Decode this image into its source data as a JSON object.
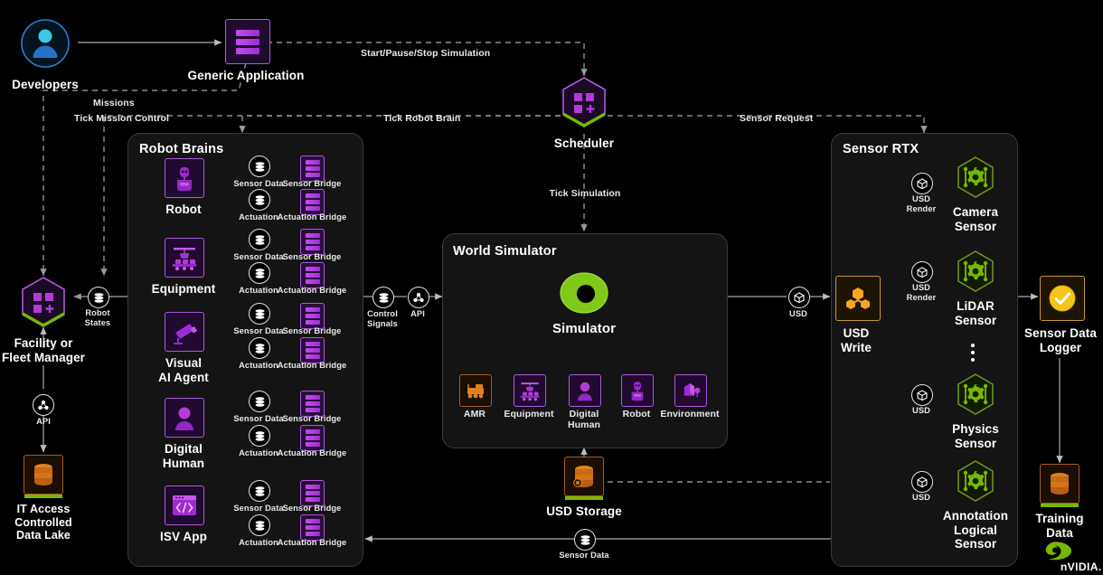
{
  "meta": {
    "brand": "NVIDIA",
    "bg": "#000000",
    "accent_purple": "#a95ad8",
    "accent_green": "#76b900",
    "accent_orange": "#e0811f",
    "accent_amber": "#f5a623"
  },
  "nodes": {
    "developers": {
      "label": "Developers",
      "icon": "person-circle-icon"
    },
    "generic_application": {
      "label": "Generic Application",
      "icon": "server-rack-icon"
    },
    "scheduler": {
      "label": "Scheduler",
      "icon": "hexagon-apps-icon"
    },
    "fleet_manager": {
      "label": "Facility or\nFleet Manager",
      "icon": "hexagon-apps-icon"
    },
    "data_lake": {
      "label": "IT Access\nControlled\nData Lake",
      "icon": "database-icon"
    },
    "usd_storage": {
      "label": "USD Storage",
      "icon": "database-usd-icon"
    },
    "usd_write": {
      "label": "USD\nWrite",
      "icon": "usd-write-icon"
    },
    "sensor_data_logger": {
      "label": "Sensor Data\nLogger",
      "icon": "check-circle-icon"
    },
    "training_data": {
      "label": "Training\nData",
      "icon": "database-icon"
    },
    "simulator": {
      "label": "Simulator",
      "icon": "torus-icon"
    }
  },
  "panels": {
    "robot_brains": {
      "title": "Robot Brains"
    },
    "world_simulator": {
      "title": "World Simulator"
    },
    "sensor_rtx": {
      "title": "Sensor RTX"
    }
  },
  "robot_brains": {
    "rows": [
      {
        "name": "Robot",
        "icon": "robot-icon",
        "sensor_data": "Sensor Data",
        "sensor_bridge": "Sensor Bridge",
        "actuation": "Actuation",
        "actuation_bridge": "Actuation Bridge"
      },
      {
        "name": "Equipment",
        "icon": "equipment-icon",
        "sensor_data": "Sensor Data",
        "sensor_bridge": "Sensor Bridge",
        "actuation": "Actuation",
        "actuation_bridge": "Actuation Bridge"
      },
      {
        "name": "Visual\nAI Agent",
        "icon": "camera-icon",
        "sensor_data": "Sensor Data",
        "sensor_bridge": "Sensor Bridge",
        "actuation": "Actuation",
        "actuation_bridge": "Actuation Bridge"
      },
      {
        "name": "Digital\nHuman",
        "icon": "digital-human-icon",
        "sensor_data": "Sensor Data",
        "sensor_bridge": "Sensor Bridge",
        "actuation": "Actuation",
        "actuation_bridge": "Actuation Bridge"
      },
      {
        "name": "ISV App",
        "icon": "code-window-icon",
        "sensor_data": "Sensor Data",
        "sensor_bridge": "Sensor Bridge",
        "actuation": "Actuation",
        "actuation_bridge": "Actuation Bridge"
      }
    ]
  },
  "world_simulator": {
    "assets": [
      {
        "label": "AMR",
        "icon": "amr-icon",
        "color": "#e0811f"
      },
      {
        "label": "Equipment",
        "icon": "equipment-icon",
        "color": "#a95ad8"
      },
      {
        "label": "Digital\nHuman",
        "icon": "digital-human-icon",
        "color": "#a95ad8"
      },
      {
        "label": "Robot",
        "icon": "robot-icon",
        "color": "#a95ad8"
      },
      {
        "label": "Environment",
        "icon": "environment-icon",
        "color": "#a95ad8"
      }
    ]
  },
  "sensor_rtx": {
    "sensors": [
      {
        "label": "Camera\nSensor",
        "badge": "USD\nRender",
        "icon": "sensor-hex-icon"
      },
      {
        "label": "LiDAR\nSensor",
        "badge": "USD\nRender",
        "icon": "sensor-hex-icon"
      },
      {
        "label": "Physics\nSensor",
        "badge": "USD",
        "icon": "sensor-hex-icon"
      },
      {
        "label": "Annotation\nLogical\nSensor",
        "badge": "USD",
        "icon": "sensor-hex-icon"
      }
    ],
    "ellipsis": "•"
  },
  "edges": {
    "start_pause_stop": "Start/Pause/Stop Simulation",
    "missions": "Missions",
    "tick_mission_control": "Tick Mission Control",
    "tick_robot_brain": "Tick Robot Brain",
    "tick_simulation": "Tick Simulation",
    "sensor_request": "Sensor Request",
    "robot_states": "Robot\nStates",
    "control_signals": "Control\nSignals",
    "api_mid": "API",
    "api_left": "API",
    "usd_mid": "USD",
    "sensor_data_bottom": "Sensor Data"
  }
}
